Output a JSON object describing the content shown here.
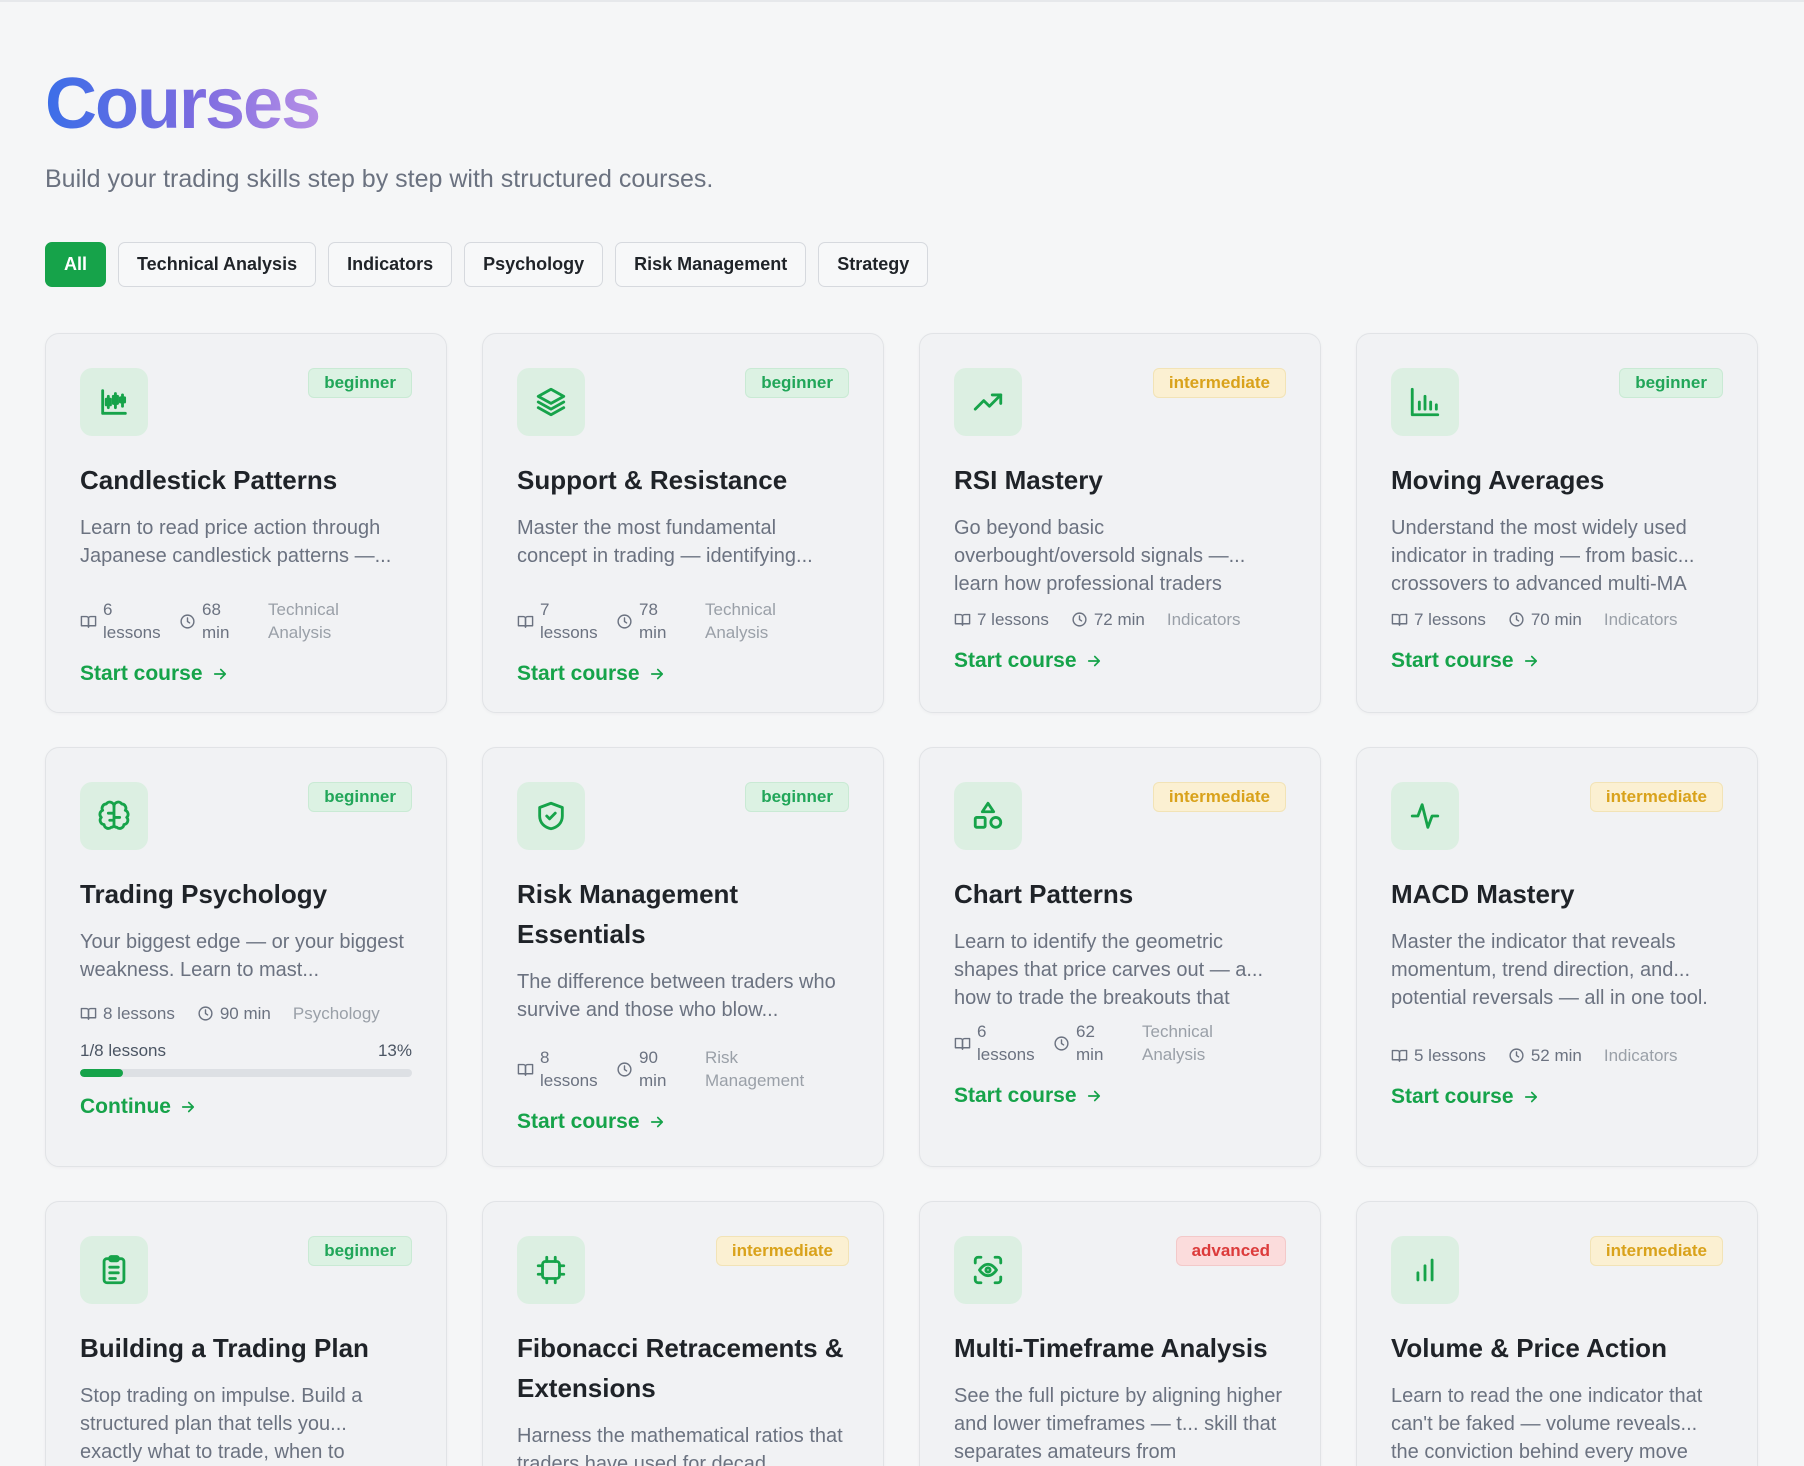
{
  "header": {
    "title": "Courses",
    "subtitle": "Build your trading skills step by step with structured courses."
  },
  "filters": [
    "All",
    "Technical Analysis",
    "Indicators",
    "Psychology",
    "Risk Management",
    "Strategy"
  ],
  "active_filter": "All",
  "colors": {
    "accent": "#16a34a",
    "beginner": "#21a659",
    "intermediate": "#d9a21b",
    "advanced": "#dc3b3b"
  },
  "courses": [
    {
      "icon": "candlestick-icon",
      "level": "beginner",
      "title": "Candlestick Patterns",
      "description": "Learn to read price action through Japanese candlestick patterns —...",
      "lessons": "6 lessons",
      "duration": "68 min",
      "category": "Technical Analysis",
      "cta": "Start course"
    },
    {
      "icon": "layers-icon",
      "level": "beginner",
      "title": "Support & Resistance",
      "description": "Master the most fundamental concept in trading — identifying...",
      "lessons": "7 lessons",
      "duration": "78 min",
      "category": "Technical Analysis",
      "cta": "Start course"
    },
    {
      "icon": "trending-up-icon",
      "level": "intermediate",
      "title": "RSI Mastery",
      "description": "Go beyond basic overbought/oversold signals —... learn how professional traders",
      "lessons": "7 lessons",
      "duration": "72 min",
      "category": "Indicators",
      "cta": "Start course"
    },
    {
      "icon": "bar-chart-icon",
      "level": "beginner",
      "title": "Moving Averages",
      "description": "Understand the most widely used indicator in trading — from basic... crossovers to advanced multi-MA",
      "lessons": "7 lessons",
      "duration": "70 min",
      "category": "Indicators",
      "cta": "Start course"
    },
    {
      "icon": "brain-icon",
      "level": "beginner",
      "title": "Trading Psychology",
      "description": "Your biggest edge — or your biggest weakness. Learn to mast...",
      "lessons": "8 lessons",
      "duration": "90 min",
      "category": "Psychology",
      "progress_label": "1/8 lessons",
      "progress_pct_label": "13%",
      "progress": 0.13,
      "cta": "Continue"
    },
    {
      "icon": "shield-check-icon",
      "level": "beginner",
      "title": "Risk Management Essentials",
      "description": "The difference between traders who survive and those who blow...",
      "lessons": "8 lessons",
      "duration": "90 min",
      "category": "Risk Management",
      "cta": "Start course"
    },
    {
      "icon": "shapes-icon",
      "level": "intermediate",
      "title": "Chart Patterns",
      "description": "Learn to identify the geometric shapes that price carves out — a... how to trade the breakouts that",
      "lessons": "6 lessons",
      "duration": "62 min",
      "category": "Technical Analysis",
      "cta": "Start course"
    },
    {
      "icon": "activity-icon",
      "level": "intermediate",
      "title": "MACD Mastery",
      "description": "Master the indicator that reveals momentum, trend direction, and... potential reversals — all in one tool.",
      "lessons": "5 lessons",
      "duration": "52 min",
      "category": "Indicators",
      "cta": "Start course"
    },
    {
      "icon": "clipboard-list-icon",
      "level": "beginner",
      "title": "Building a Trading Plan",
      "description": "Stop trading on impulse. Build a structured plan that tells you... exactly what to trade, when to"
    },
    {
      "icon": "frame-icon",
      "level": "intermediate",
      "title": "Fibonacci Retracements & Extensions",
      "description": "Harness the mathematical ratios that traders have used for decad..."
    },
    {
      "icon": "scan-eye-icon",
      "level": "advanced",
      "title": "Multi-Timeframe Analysis",
      "description": "See the full picture by aligning higher and lower timeframes — t... skill that separates amateurs from"
    },
    {
      "icon": "volume-bars-icon",
      "level": "intermediate",
      "title": "Volume & Price Action",
      "description": "Learn to read the one indicator that can't be faked — volume reveals... the conviction behind every move"
    }
  ]
}
